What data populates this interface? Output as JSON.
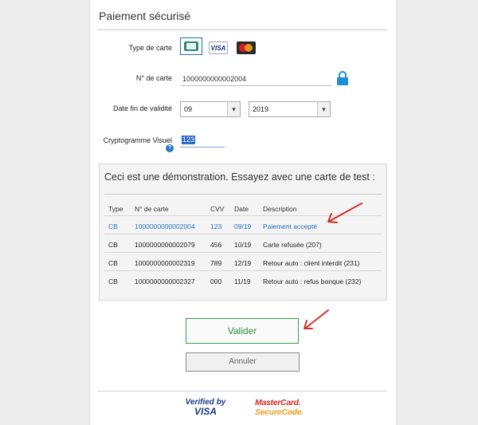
{
  "page": {
    "title": "Paiement sécurisé"
  },
  "form": {
    "card_type_label": "Type de carte",
    "card_types": {
      "cb": "CB",
      "visa": "VISA",
      "mastercard": "MasterCard"
    },
    "card_number_label": "N° de carte",
    "card_number_value": "1000000000002004",
    "expiry_label": "Date fin de validité",
    "expiry_month": "09",
    "expiry_year": "2019",
    "cvv_label": "Cryptogramme Visuel",
    "cvv_value": "123",
    "help_glyph": "?"
  },
  "demo": {
    "heading": "Ceci est une démonstration. Essayez avec une carte de test :",
    "columns": [
      "Type",
      "N° de carte",
      "CVV",
      "Date",
      "Description"
    ],
    "rows": [
      [
        "CB",
        "1000000000002004",
        "123",
        "09/19",
        "Paiement accepté"
      ],
      [
        "CB",
        "1000000000002079",
        "456",
        "10/19",
        "Carte refusée (207)"
      ],
      [
        "CB",
        "1000000000002319",
        "789",
        "12/19",
        "Retour auto : client interdit (231)"
      ],
      [
        "CB",
        "1000000000002327",
        "000",
        "11/19",
        "Retour auto : refus banque (232)"
      ]
    ]
  },
  "buttons": {
    "validate": "Valider",
    "cancel": "Annuler"
  },
  "footer": {
    "verified_line1": "Verified by",
    "verified_line2": "VISA",
    "mc_line1": "MasterCard.",
    "mc_line2": "SecureCode."
  },
  "colors": {
    "accent_blue": "#1f6fc0",
    "arrow_red": "#d0302a",
    "validate_green": "#2e8b3d"
  }
}
